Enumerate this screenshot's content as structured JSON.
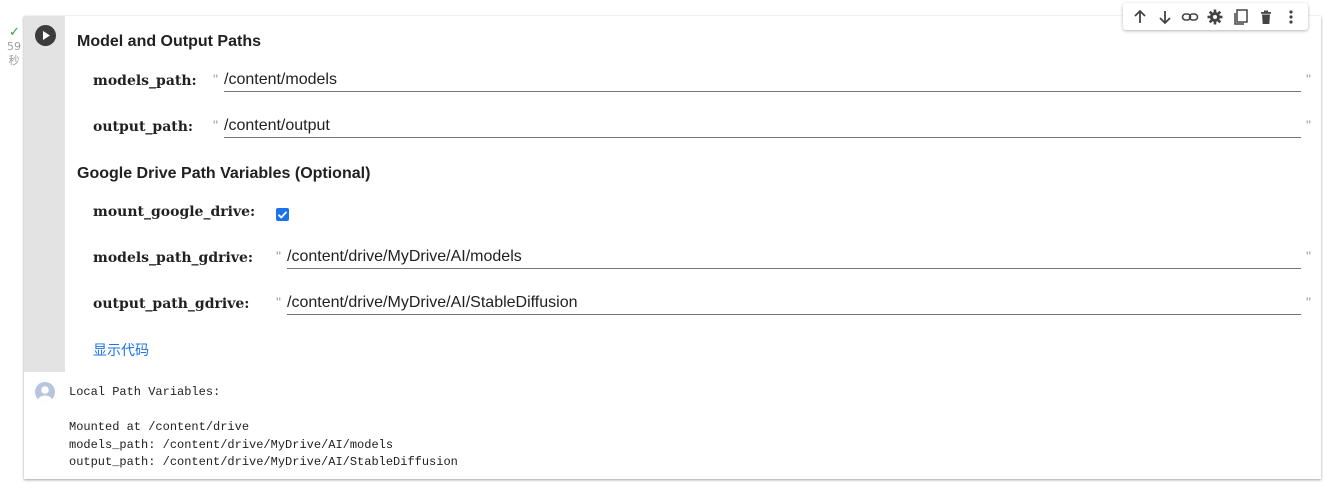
{
  "status": {
    "check": "✓",
    "time_value": "59",
    "time_unit": "秒"
  },
  "toolbar": {
    "buttons": [
      "arrow-up-icon",
      "arrow-down-icon",
      "link-icon",
      "gear-icon",
      "mirror-cell-icon",
      "trash-icon",
      "more-vert-icon"
    ]
  },
  "form": {
    "section1_title": "Model and Output Paths",
    "models_path": {
      "label": "models_path:",
      "value": "/content/models"
    },
    "output_path": {
      "label": "output_path:",
      "value": "/content/output"
    },
    "section2_title": "Google Drive Path Variables (Optional)",
    "mount_google_drive": {
      "label": "mount_google_drive:",
      "checked": true
    },
    "models_path_gdrive": {
      "label": "models_path_gdrive:",
      "value": "/content/drive/MyDrive/AI/models"
    },
    "output_path_gdrive": {
      "label": "output_path_gdrive:",
      "value": "/content/drive/MyDrive/AI/StableDiffusion"
    },
    "show_code": "显示代码"
  },
  "output": {
    "lines": [
      "Local Path Variables:",
      "",
      "Mounted at /content/drive",
      "models_path: /content/drive/MyDrive/AI/models",
      "output_path: /content/drive/MyDrive/AI/StableDiffusion"
    ]
  },
  "quote_char": "\"",
  "colors": {
    "accent": "#1a73e8",
    "success": "#2e9d4f",
    "gutter": "#e3e3e3"
  }
}
